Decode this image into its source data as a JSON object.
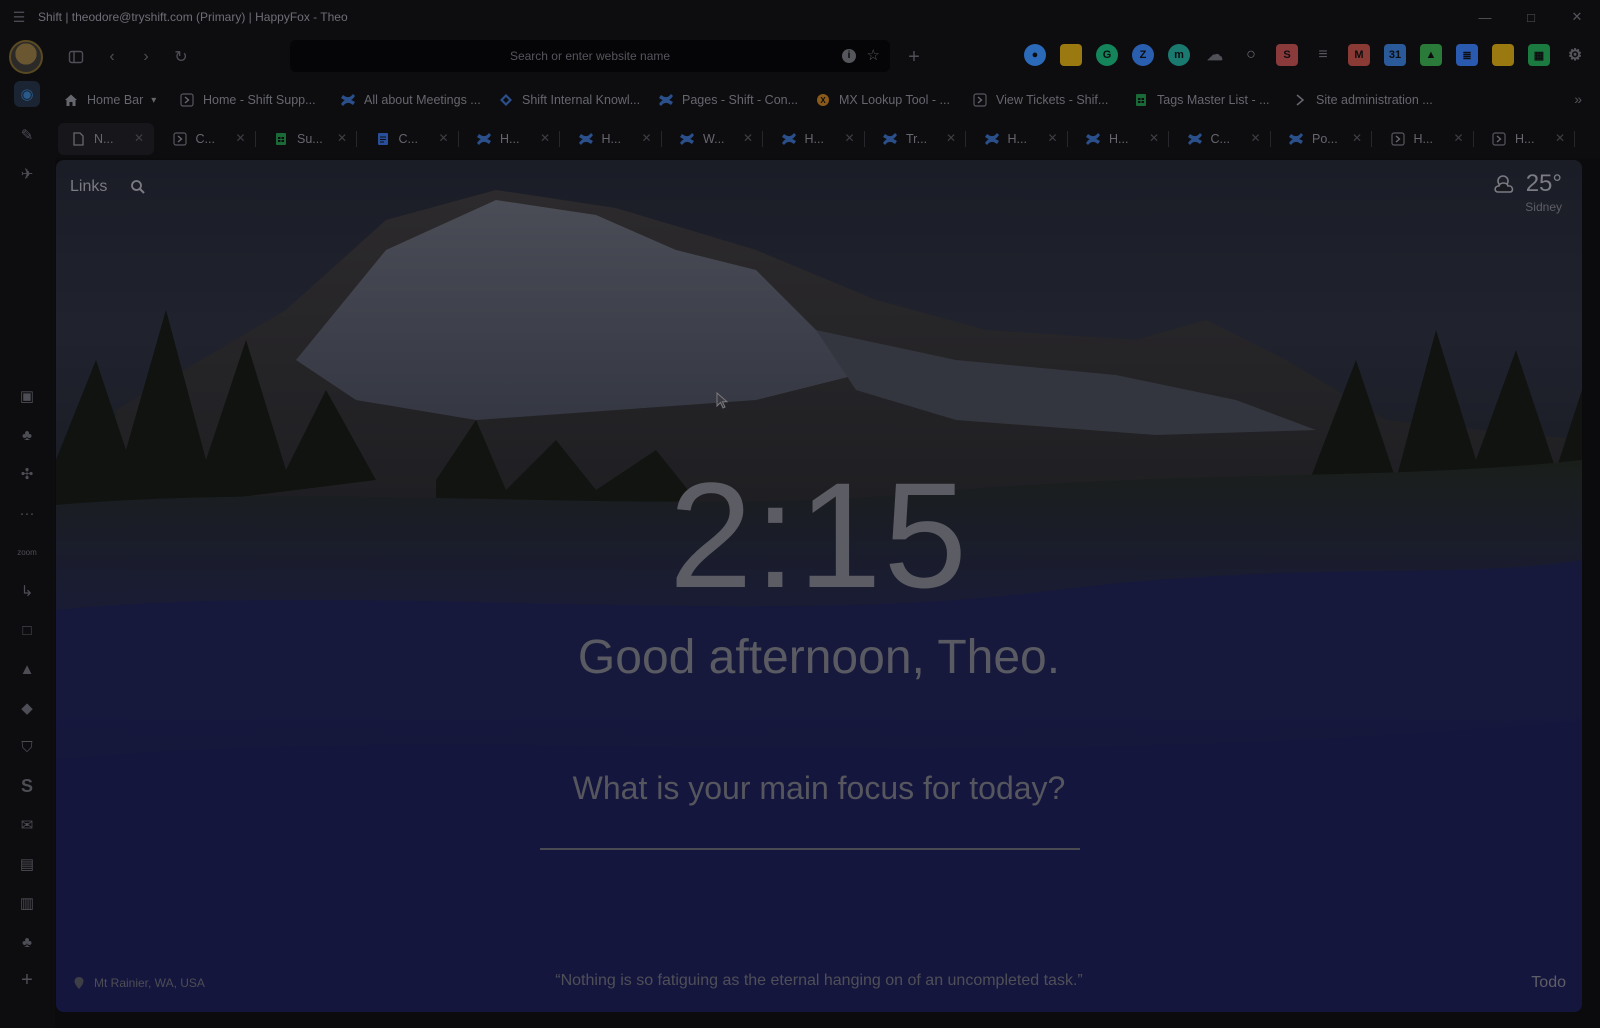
{
  "window": {
    "title": "Shift | theodore@tryshift.com (Primary) | HappyFox - Theo",
    "controls": [
      "—",
      "□",
      "✕"
    ]
  },
  "toolbar": {
    "url_placeholder": "Search or enter website name",
    "new_tab": "+"
  },
  "extensions": [
    {
      "name": "google-workspace-icon",
      "color": "#2a6ab8",
      "glyph": "●"
    },
    {
      "name": "sticky-note-icon",
      "color": "#9a7a10",
      "glyph": ""
    },
    {
      "name": "grammarly-icon",
      "color": "#14855a",
      "glyph": "G"
    },
    {
      "name": "zoom-icon",
      "color": "#2a5fb0",
      "glyph": "Z"
    },
    {
      "name": "meet-icon",
      "color": "#1a7a70",
      "glyph": "m"
    },
    {
      "name": "cloud-icon",
      "color": "#505058",
      "glyph": "☁"
    },
    {
      "name": "record-icon",
      "color": "#6a6a72",
      "glyph": "○"
    },
    {
      "name": "red-ext-icon",
      "color": "#8a3a3a",
      "glyph": "S"
    },
    {
      "name": "layers-icon",
      "color": "#55555c",
      "glyph": "≡"
    },
    {
      "name": "gmail-icon",
      "color": "#8a3a34",
      "glyph": "M"
    },
    {
      "name": "calendar-icon",
      "color": "#2a5a9a",
      "glyph": "31"
    },
    {
      "name": "drive-icon",
      "color": "#2a7a3a",
      "glyph": "▲"
    },
    {
      "name": "docs-icon",
      "color": "#2a5ab0",
      "glyph": "≣"
    },
    {
      "name": "keep-icon",
      "color": "#9a7a10",
      "glyph": ""
    },
    {
      "name": "sheets-icon",
      "color": "#1a7a40",
      "glyph": "▦"
    },
    {
      "name": "settings-icon",
      "color": "#55555c",
      "glyph": "⚙"
    }
  ],
  "bookmarks": [
    {
      "label": "Home Bar",
      "icon": "home"
    },
    {
      "label": "Home - Shift Supp...",
      "icon": "shift"
    },
    {
      "label": "All about Meetings ...",
      "icon": "confluence"
    },
    {
      "label": "Shift Internal Knowl...",
      "icon": "diamond"
    },
    {
      "label": "Pages - Shift - Con...",
      "icon": "confluence"
    },
    {
      "label": "MX Lookup Tool - ...",
      "icon": "mx"
    },
    {
      "label": "View Tickets - Shif...",
      "icon": "shift"
    },
    {
      "label": "Tags Master List - ...",
      "icon": "sheets"
    },
    {
      "label": "Site administration ...",
      "icon": "chevron"
    }
  ],
  "tabs": [
    {
      "label": "N...",
      "icon": "page",
      "active": true
    },
    {
      "label": "C...",
      "icon": "shift"
    },
    {
      "label": "Su...",
      "icon": "sheets"
    },
    {
      "label": "C...",
      "icon": "docs"
    },
    {
      "label": "H...",
      "icon": "confluence"
    },
    {
      "label": "H...",
      "icon": "confluence"
    },
    {
      "label": "W...",
      "icon": "confluence"
    },
    {
      "label": "H...",
      "icon": "confluence"
    },
    {
      "label": "Tr...",
      "icon": "confluence"
    },
    {
      "label": "H...",
      "icon": "confluence"
    },
    {
      "label": "H...",
      "icon": "confluence"
    },
    {
      "label": "C...",
      "icon": "confluence"
    },
    {
      "label": "Po...",
      "icon": "confluence"
    },
    {
      "label": "H...",
      "icon": "shift"
    },
    {
      "label": "H...",
      "icon": "shift"
    }
  ],
  "sidebar_apps": [
    "google-workspace-icon",
    "pin-icon",
    "rocket-icon",
    "gmail-square-icon",
    "people-icon",
    "slack-icon",
    "more-dots-icon",
    "zoom-text-icon",
    "shift-hook-icon",
    "square-icon",
    "drive-icon",
    "diamond-icon",
    "shield-icon",
    "s-icon",
    "mail-icon",
    "doc-icon",
    "doc2-icon",
    "people2-icon",
    "add-app-icon"
  ],
  "momentum": {
    "links_label": "Links",
    "weather_temp": "25°",
    "weather_city": "Sidney",
    "time": "2:15",
    "greeting": "Good afternoon, Theo.",
    "focus_question": "What is your main focus for today?",
    "focus_value": "",
    "location": "Mt Rainier, WA, USA",
    "quote": "“Nothing is so fatiguing as the eternal hanging on of an uncompleted task.”",
    "todo_label": "Todo"
  }
}
